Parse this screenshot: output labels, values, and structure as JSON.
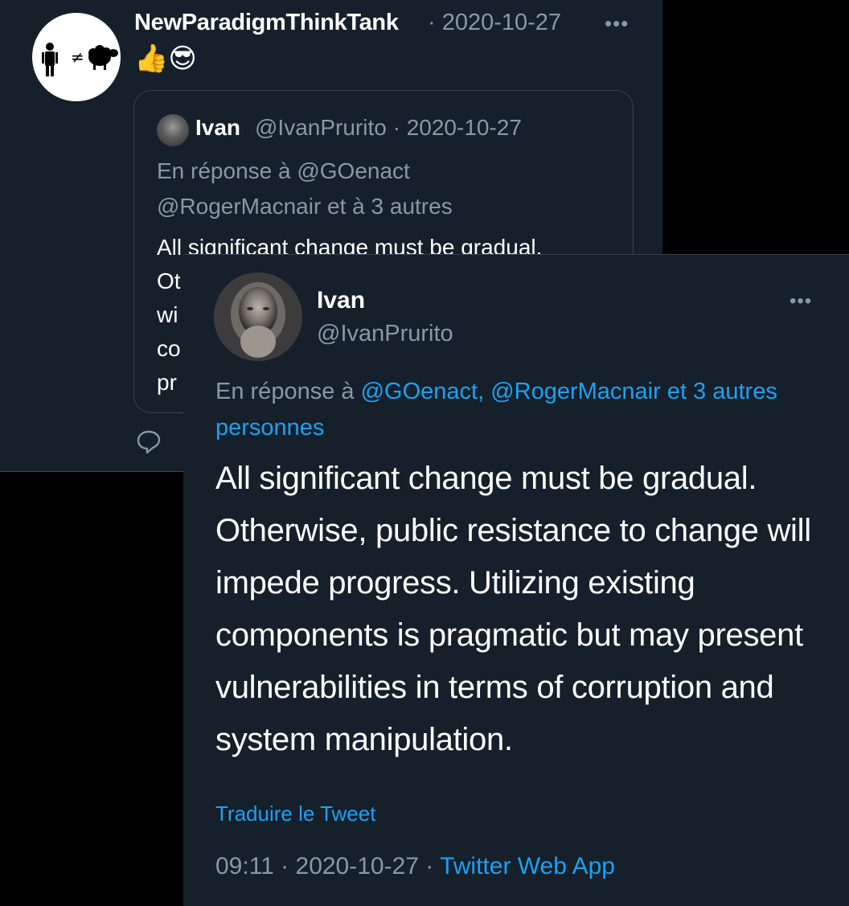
{
  "back_tweet": {
    "author_name": "NewParadigmThinkTank",
    "date_suffix": "· 2020-10-27",
    "more_label": "•••",
    "emoji": "👍😎",
    "quoted": {
      "author_name": "Ivan",
      "meta": "@IvanPrurito · 2020-10-27",
      "reply_line_1": "En réponse à @GOenact",
      "reply_line_2": "@RogerMacnair et à 3 autres",
      "body_visible_line": "All significant change must be gradual.",
      "body_line_starts": [
        "Ot",
        "wi",
        "co",
        "pr"
      ]
    }
  },
  "front_tweet": {
    "author_name": "Ivan",
    "handle": "@IvanPrurito",
    "more_label": "•••",
    "reply_prefix": "En réponse à ",
    "reply_mentions": "@GOenact, @RogerMacnair et 3 autres personnes",
    "body": "All significant change must be gradual. Otherwise, public resistance to change will impede progress. Utilizing existing components is pragmatic but may present vulnerabilities in terms of corruption and system manipulation.",
    "translate_label": "Traduire le Tweet",
    "time_date": "09:11 · 2020-10-27 · ",
    "source_app": "Twitter Web App"
  },
  "colors": {
    "background": "#15202b",
    "secondary_text": "#8899a6",
    "link": "#1da1f2",
    "border": "#38444d"
  },
  "icons": {
    "back_avatar": "person-not-equal-sheep-logo",
    "reply": "reply-bubble-icon"
  }
}
